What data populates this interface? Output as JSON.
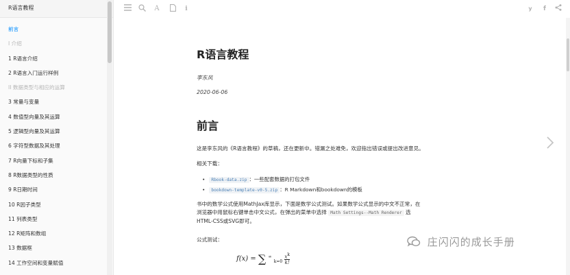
{
  "sidebar": {
    "book_title": "R语言教程",
    "items": [
      {
        "label": "前言",
        "state": "active"
      },
      {
        "label": "I 介绍",
        "state": "part"
      },
      {
        "label": "1 R语言介绍",
        "state": ""
      },
      {
        "label": "2 R语言入门运行样例",
        "state": ""
      },
      {
        "label": "II 数据类型与相应的运算",
        "state": "part"
      },
      {
        "label": "3 常量与变量",
        "state": ""
      },
      {
        "label": "4 数值型向量及其运算",
        "state": ""
      },
      {
        "label": "5 逻辑型向量及其运算",
        "state": ""
      },
      {
        "label": "6 字符型数据及其处理",
        "state": ""
      },
      {
        "label": "7 R向量下标和子集",
        "state": ""
      },
      {
        "label": "8 R数据类型的性质",
        "state": ""
      },
      {
        "label": "9 R日期时间",
        "state": ""
      },
      {
        "label": "10 R因子类型",
        "state": ""
      },
      {
        "label": "11 列表类型",
        "state": ""
      },
      {
        "label": "12 R矩阵和数组",
        "state": ""
      },
      {
        "label": "13 数据框",
        "state": ""
      },
      {
        "label": "14 工作空间和变量赋值",
        "state": ""
      }
    ]
  },
  "toolbar": {
    "left_icons": [
      "menu-icon",
      "search-icon",
      "font-icon",
      "pdf-icon",
      "info-icon"
    ],
    "right_icons": [
      "twitter-icon",
      "facebook-icon",
      "share-icon"
    ],
    "font_glyph": "A",
    "info_glyph": "i",
    "twitter_glyph": "y",
    "facebook_glyph": "f"
  },
  "content": {
    "title": "R语言教程",
    "author": "李东风",
    "date": "2020-06-06",
    "section_heading": "前言",
    "intro": "这是李东风的《R语言教程》的草稿，还在更新中。错漏之处难免，欢迎指出错误或提出改进意见。",
    "download_label": "相关下载：",
    "downloads": [
      {
        "file": "Rbook-data.zip",
        "desc": "：一些配套数据的打包文件"
      },
      {
        "file": "bookdown-template-v0-5.zip",
        "desc": "：R Markdown和bookdown的模板"
      }
    ],
    "mathjax_part1": "书中的数学公式使用MathJax库显示，下面是数学公式测试。如果数学公式显示的中文不正常，在浏览器中用鼠标右键单击中文公式，在弹出的菜单中选择",
    "mathjax_code": "Math Settings--Math Renderer",
    "mathjax_part2": "选HTML-CSS或SVG即可。",
    "formula_label": "公式测试：",
    "formula": {
      "lhs": "f(x) = ",
      "sum_symbol": "∑",
      "upper": "∞",
      "lower": "k=0",
      "numerator": "x",
      "numerator_exp": "k",
      "denominator": "k!"
    }
  },
  "watermark": "庄闪闪的成长手册",
  "colors": {
    "accent": "#008cff",
    "code_text": "#4a7fb5",
    "part_label": "#b5b5b5"
  }
}
